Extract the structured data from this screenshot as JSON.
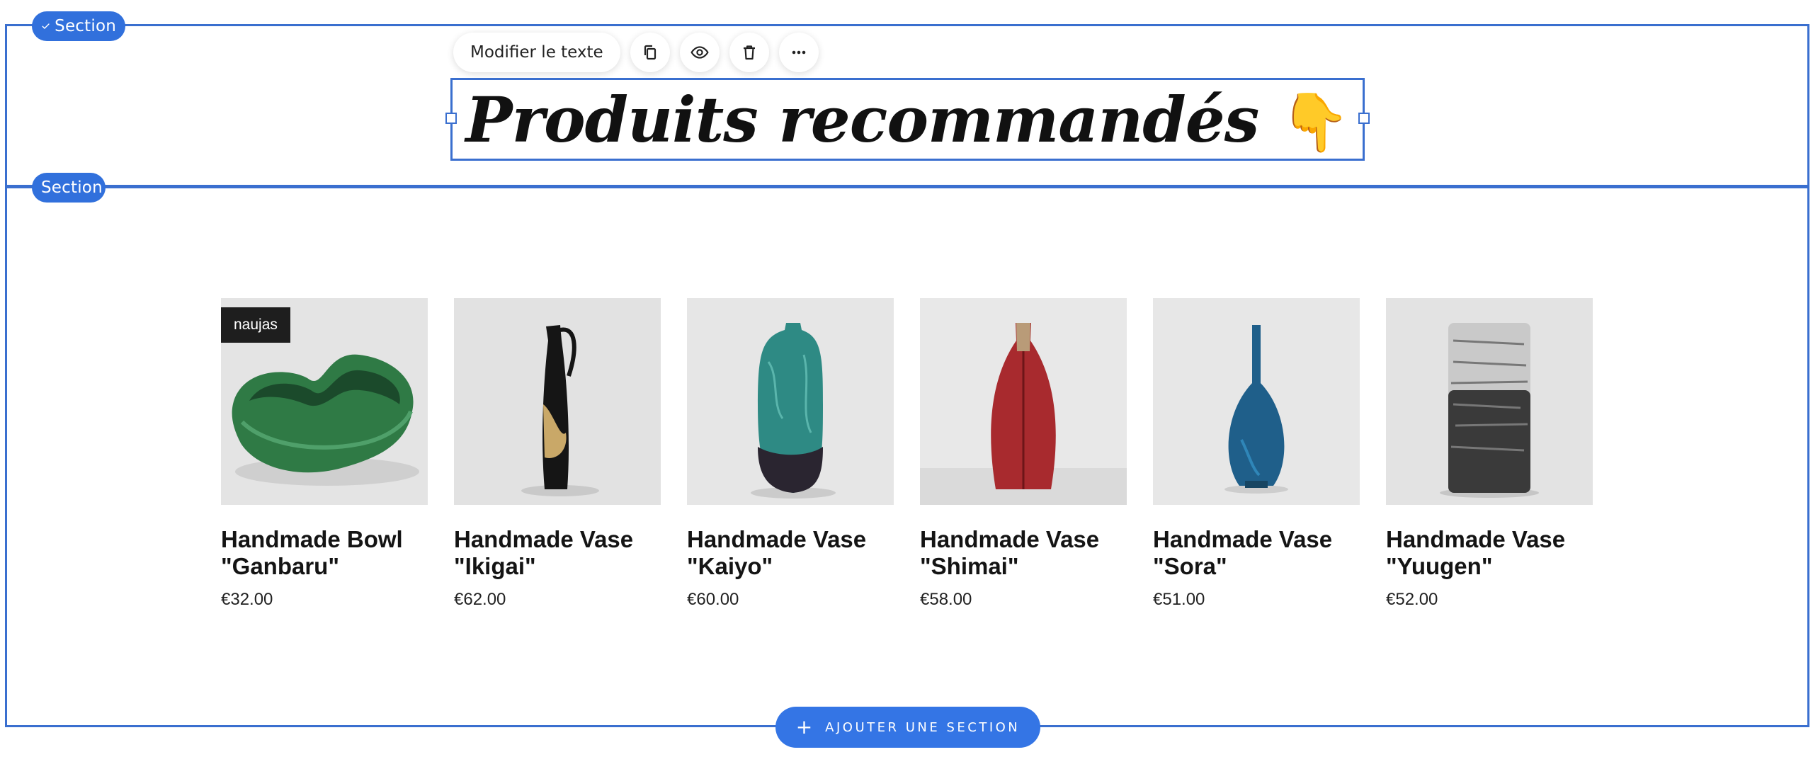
{
  "sections": {
    "first_tag": "Section",
    "second_tag": "Section"
  },
  "toolbar": {
    "edit_text_label": "Modifier le texte",
    "icons": [
      "copy-icon",
      "eye-icon",
      "trash-icon",
      "more-icon"
    ]
  },
  "heading": {
    "text": "Produits recommandés",
    "emoji": "👇"
  },
  "products": [
    {
      "name": "Handmade Bowl \"Ganbaru\"",
      "price": "€32.00",
      "badge": "naujas"
    },
    {
      "name": "Handmade Vase \"Ikigai\"",
      "price": "€62.00"
    },
    {
      "name": "Handmade Vase \"Kaiyo\"",
      "price": "€60.00"
    },
    {
      "name": "Handmade Vase \"Shimai\"",
      "price": "€58.00"
    },
    {
      "name": "Handmade Vase \"Sora\"",
      "price": "€51.00"
    },
    {
      "name": "Handmade Vase \"Yuugen\"",
      "price": "€52.00"
    }
  ],
  "add_section": {
    "label": "AJOUTER UNE SECTION"
  },
  "colors": {
    "accent": "#3170dc",
    "outline": "#3a6fcf"
  }
}
